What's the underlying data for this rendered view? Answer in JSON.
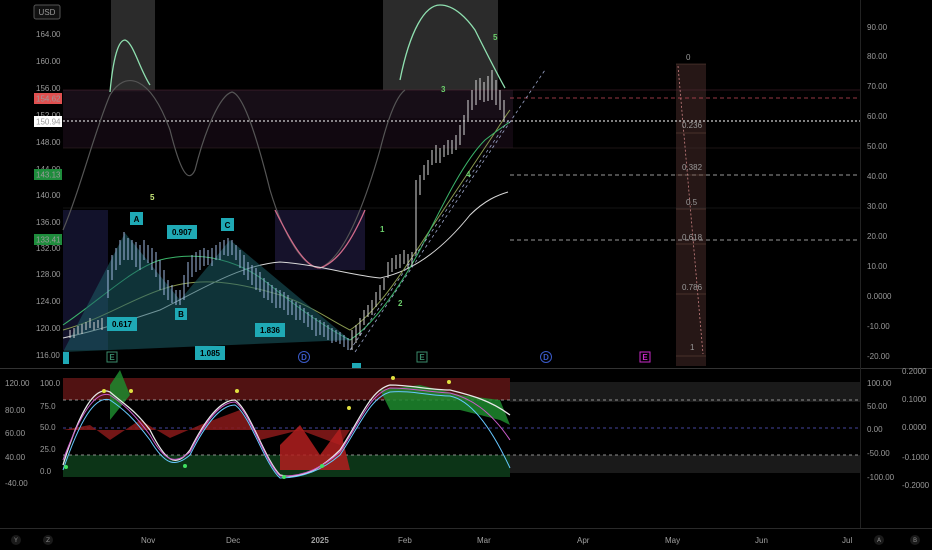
{
  "currency_button": "USD",
  "price_axis": {
    "ticks": [
      "164.00",
      "160.00",
      "156.00",
      "152.00",
      "148.00",
      "144.00",
      "140.00",
      "136.00",
      "132.00",
      "128.00",
      "124.00",
      "120.00",
      "116.00"
    ],
    "badges": [
      {
        "label": "154.62",
        "bg": "#e05050",
        "fg": "#ffffff"
      },
      {
        "label": "150.94",
        "bg": "#ffffff",
        "fg": "#000000"
      },
      {
        "label": "143.13",
        "bg": "#1e8c3c",
        "fg": "#ffffff"
      },
      {
        "label": "133.41",
        "bg": "#1e8c3c",
        "fg": "#ffffff"
      }
    ]
  },
  "osc_axis_right": {
    "ticks": [
      "90.00",
      "80.00",
      "70.00",
      "60.00",
      "50.00",
      "40.00",
      "30.00",
      "20.00",
      "10.00",
      "0.0000",
      "-10.00",
      "-20.00"
    ]
  },
  "lower_left_axis": {
    "ticks": [
      "120.00",
      "100.0",
      "80.00",
      "75.0",
      "60.00",
      "50.0",
      "40.00",
      "25.0",
      "0.0000",
      "0.0",
      "-40.00"
    ]
  },
  "lower_right_axis": {
    "ticks": [
      "100.00",
      "50.00",
      "0.00",
      "-50.00",
      "-100.00"
    ]
  },
  "lower_far_axis": {
    "ticks": [
      "0.2000",
      "0.1000",
      "0.0000",
      "-0.1000",
      "-0.2000"
    ]
  },
  "time_axis": {
    "labels": [
      "Nov",
      "Dec",
      "2025",
      "Feb",
      "Mar",
      "Apr",
      "May",
      "Jun",
      "Jul"
    ]
  },
  "wave_labels": {
    "A": "A",
    "B": "B",
    "C": "C",
    "D": "D",
    "E": "E",
    "n1": "1",
    "n2": "2",
    "n3": "3",
    "n4": "4",
    "n5": "5",
    "n5b": "5"
  },
  "ratio_labels": {
    "r1": "0.907",
    "r2": "0.617",
    "r3": "1.836",
    "r4": "1.085"
  },
  "fib_levels": [
    "0",
    "0.236",
    "0.382",
    "0.5",
    "0.618",
    "0.786",
    "1"
  ],
  "event_markers": {
    "d1": "D",
    "d2": "D",
    "e1": "E",
    "e2": "E",
    "e3": "E"
  },
  "corner_icons": {
    "y": "Y",
    "z": "Z",
    "a": "A",
    "b": "B"
  },
  "colors": {
    "bull": "#26a69a",
    "bear": "#ef5350",
    "accent": "#2962ff"
  }
}
